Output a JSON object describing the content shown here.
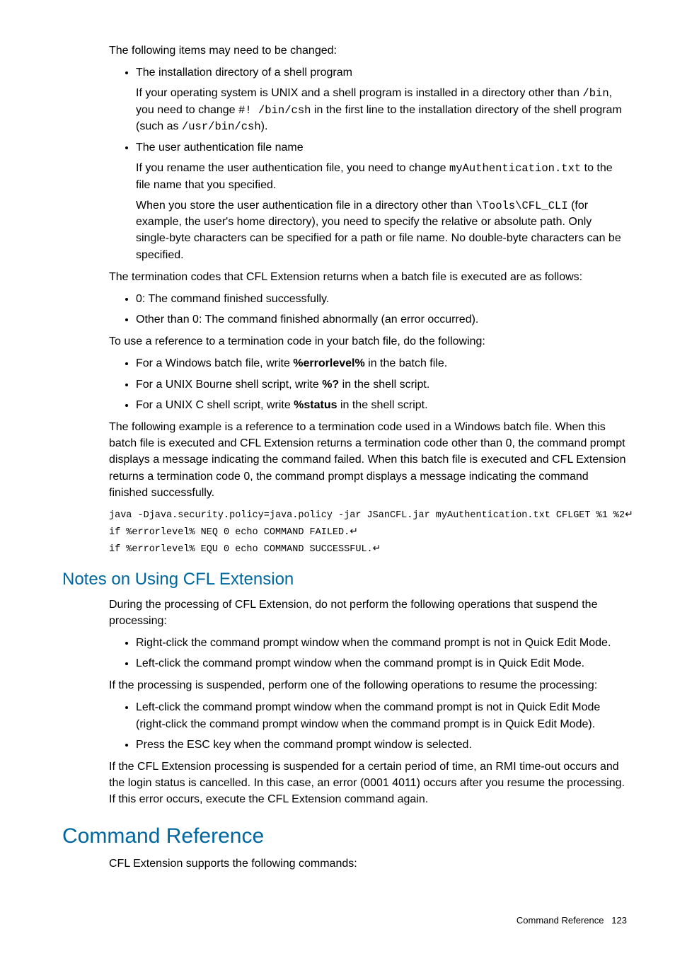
{
  "p_intro": "The following items may need to be changed:",
  "bullets1": {
    "item1": {
      "lead": "The installation directory of a shell program",
      "body_pre": "If your operating system is UNIX and a shell program is installed in a directory other than ",
      "code1": "/bin",
      "body_mid": ", you need to change ",
      "code2": "#! /bin/csh",
      "body_mid2": " in the first line to the installation directory of the shell program (such as ",
      "code3": "/usr/bin/csh",
      "body_end": ")."
    },
    "item2": {
      "lead": "The user authentication file name",
      "p1_pre": "If you rename the user authentication file, you need to change ",
      "p1_code": "myAuthentication.txt",
      "p1_post": " to the file name that you specified.",
      "p2_pre": "When you store the user authentication file in a directory other than ",
      "p2_code": "\\Tools\\CFL_CLI",
      "p2_post": " (for example, the user's home directory), you need to specify the relative or absolute path. Only single-byte characters can be specified for a path or file name. No double-byte characters can be specified."
    }
  },
  "p_termcodes": "The termination codes that CFL Extension returns when a batch file is executed are as follows:",
  "bullets2": {
    "item1": "0: The command finished successfully.",
    "item2": "Other than 0: The command finished abnormally (an error occurred)."
  },
  "p_use_ref": "To use a reference to a termination code in your batch file, do the following:",
  "bullets3": {
    "item1_pre": "For a Windows batch file, write ",
    "item1_bold": "%errorlevel%",
    "item1_post": " in the batch file.",
    "item2_pre": "For a UNIX Bourne shell script, write ",
    "item2_bold": "%?",
    "item2_post": " in the shell script.",
    "item3_pre": "For a UNIX C shell script, write ",
    "item3_bold": "%status",
    "item3_post": " in the shell script."
  },
  "p_example": "The following example is a reference to a termination code used in a Windows batch file. When this batch file is executed and CFL Extension returns a termination code other than 0, the command prompt displays a message indicating the command failed. When this batch file is executed and CFL Extension returns a termination code 0, the command prompt displays a message indicating the command finished successfully.",
  "code": {
    "line1": "java -Djava.security.policy=java.policy -jar JSanCFL.jar myAuthentication.txt CFLGET %1 %2",
    "line2": "if %errorlevel% NEQ 0 echo COMMAND FAILED.",
    "line3": "if %errorlevel% EQU 0 echo COMMAND SUCCESSFUL.",
    "ret": "↵"
  },
  "sec_notes": {
    "title": "Notes on Using CFL Extension",
    "p1": "During the processing of CFL Extension, do not perform the following operations that suspend the processing:",
    "b1": "Right-click the command prompt window when the command prompt is not in Quick Edit Mode.",
    "b2": "Left-click the command prompt window when the command prompt is in Quick Edit Mode.",
    "p2": "If the processing is suspended, perform one of the following operations to resume the processing:",
    "b3": "Left-click the command prompt window when the command prompt is not in Quick Edit Mode (right-click the command prompt window when the command prompt is in Quick Edit Mode).",
    "b4": "Press the ESC key when the command prompt window is selected.",
    "p3": "If the CFL Extension processing is suspended for a certain period of time, an RMI time-out occurs and the login status is cancelled. In this case, an error (0001 4011) occurs after you resume the processing. If this error occurs, execute the CFL Extension command again."
  },
  "sec_cmdref": {
    "title": "Command Reference",
    "p1": "CFL Extension supports the following commands:"
  },
  "footer": {
    "label": "Command Reference",
    "page": "123"
  }
}
